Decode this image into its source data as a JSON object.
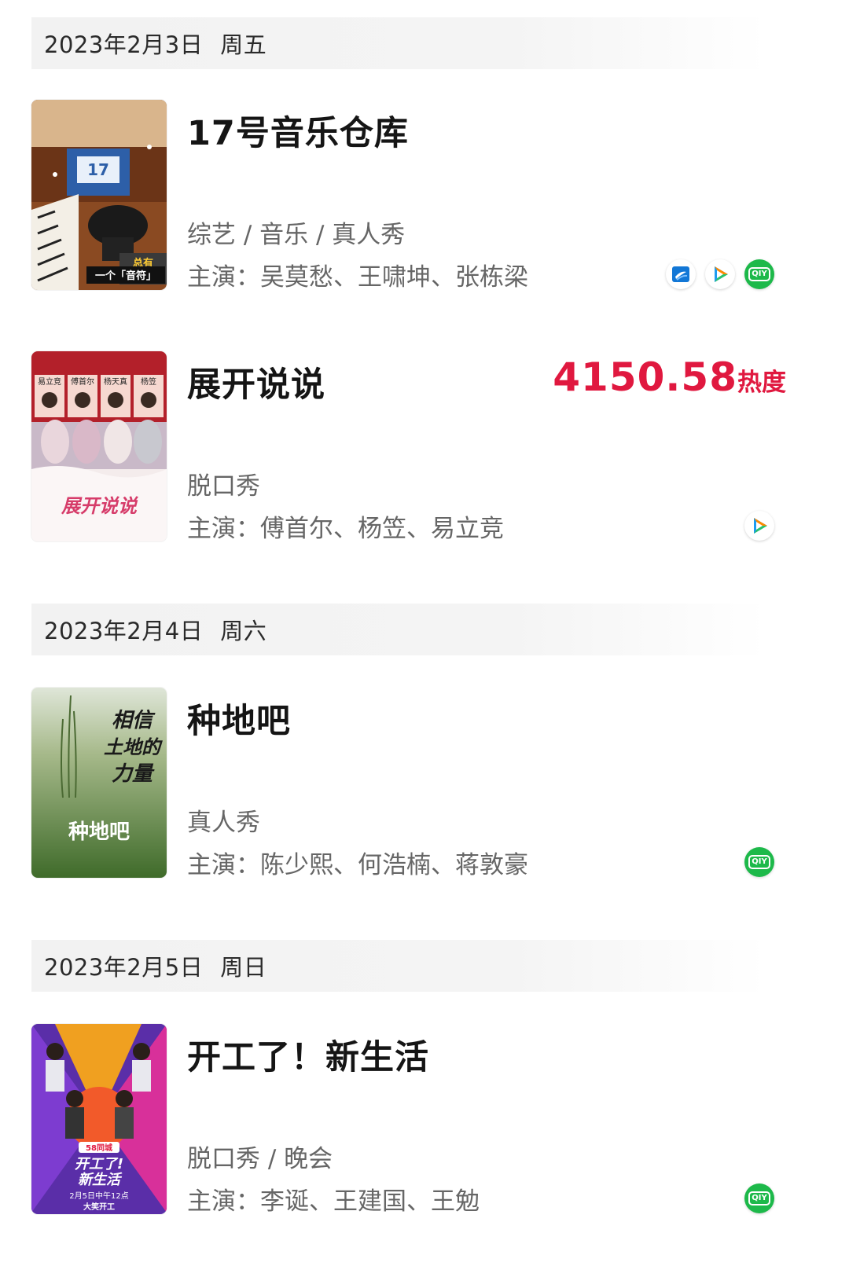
{
  "sections": [
    {
      "date": "2023年2月3日",
      "weekday": "周五",
      "shows": [
        {
          "title": "17号音乐仓库",
          "genre": "综艺 / 音乐 / 真人秀",
          "cast": "主演：吴莫愁、王啸坤、张栋梁",
          "heat": null,
          "platforms": [
            "zhejiang-tv-icon",
            "tencent-video-icon",
            "iqiyi-icon"
          ],
          "poster_text": [
            "17",
            "一个「音符」",
            "总有"
          ]
        },
        {
          "title": "展开说说",
          "genre": "脱口秀",
          "cast": "主演：傅首尔、杨笠、易立竞",
          "heat": {
            "value": "4150.58",
            "label": "热度"
          },
          "platforms": [
            "tencent-video-icon"
          ],
          "poster_text": [
            "易立竞",
            "傅首尔",
            "杨天真",
            "杨笠",
            "展开说说"
          ]
        }
      ]
    },
    {
      "date": "2023年2月4日",
      "weekday": "周六",
      "shows": [
        {
          "title": "种地吧",
          "genre": "真人秀",
          "cast": "主演：陈少熙、何浩楠、蒋敦豪",
          "heat": null,
          "platforms": [
            "iqiyi-icon"
          ],
          "poster_text": [
            "相信",
            "土地的",
            "力量",
            "种地吧"
          ]
        }
      ]
    },
    {
      "date": "2023年2月5日",
      "weekday": "周日",
      "shows": [
        {
          "title": "开工了！新生活",
          "genre": "脱口秀 / 晚会",
          "cast": "主演：李诞、王建国、王勉",
          "heat": null,
          "platforms": [
            "iqiyi-icon"
          ],
          "poster_text": [
            "58同城",
            "开工了!",
            "新生活",
            "2月5日中午12点",
            "大笑开工"
          ]
        }
      ]
    }
  ],
  "colors": {
    "heat": "#e0183f",
    "iqiyi": "#1db94a",
    "tencent_blue": "#1e9cf0",
    "tencent_orange": "#ff8a00",
    "tencent_green": "#2bc26b",
    "zhejiang_blue": "#1277d6"
  },
  "iqiyi_label": "QIY"
}
